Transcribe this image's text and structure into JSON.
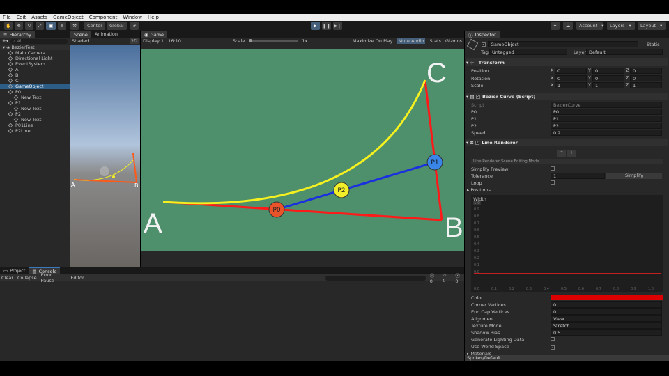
{
  "menu": [
    "File",
    "Edit",
    "Assets",
    "GameObject",
    "Component",
    "Window",
    "Help"
  ],
  "toolbar": {
    "pivot": "Center",
    "space": "Global",
    "account": "Account",
    "layers": "Layers",
    "layout": "Layout"
  },
  "hierarchy": {
    "tab": "Hierarchy",
    "search_placeholder": "All",
    "scene": "BezierTest",
    "items": [
      {
        "label": "Main Camera",
        "indent": 1
      },
      {
        "label": "Directional Light",
        "indent": 1
      },
      {
        "label": "EventSystem",
        "indent": 1
      },
      {
        "label": "A",
        "indent": 1
      },
      {
        "label": "B",
        "indent": 1
      },
      {
        "label": "C",
        "indent": 1
      },
      {
        "label": "GameObject",
        "indent": 1,
        "selected": true
      },
      {
        "label": "P0",
        "indent": 1
      },
      {
        "label": "New Text",
        "indent": 2
      },
      {
        "label": "P1",
        "indent": 1
      },
      {
        "label": "New Text",
        "indent": 2
      },
      {
        "label": "P2",
        "indent": 1
      },
      {
        "label": "New Text",
        "indent": 2
      },
      {
        "label": "P01Line",
        "indent": 1
      },
      {
        "label": "P2Line",
        "indent": 1
      }
    ]
  },
  "scene_view": {
    "tabs": [
      "Scene",
      "Animation"
    ],
    "shading": "Shaded",
    "mode": "2D",
    "labels": {
      "a": "A",
      "b": "B"
    }
  },
  "game_view": {
    "tab": "Game",
    "display": "Display 1",
    "aspect": "16:10",
    "scale_label": "Scale",
    "scale_value": "1x",
    "toggles": [
      "Maximize On Play",
      "Mute Audio",
      "Stats",
      "Gizmos"
    ],
    "background": "#4e8f6c",
    "points": {
      "a": "A",
      "b": "B",
      "c": "C",
      "p0": "P0",
      "p1": "P1",
      "p2": "P2"
    },
    "colors": {
      "red": "#ff1a1a",
      "blue": "#1a2fe0",
      "yellow": "#f5f020",
      "p0": "#e8532a",
      "p1": "#3a86e8",
      "p2": "#f2ee2a"
    }
  },
  "bottom": {
    "tabs": [
      "Project",
      "Console"
    ],
    "buttons": [
      "Clear",
      "Collapse",
      "Error Pause",
      "Editor"
    ],
    "counts": [
      "0",
      "0",
      "0"
    ]
  },
  "inspector": {
    "tab": "Inspector",
    "name": "GameObject",
    "static": "Static",
    "tag_label": "Tag",
    "tag": "Untagged",
    "layer_label": "Layer",
    "layer": "Default",
    "transform": {
      "title": "Transform",
      "position": {
        "label": "Position",
        "x": "0",
        "y": "0",
        "z": "0"
      },
      "rotation": {
        "label": "Rotation",
        "x": "0",
        "y": "0",
        "z": "0"
      },
      "scale": {
        "label": "Scale",
        "x": "1",
        "y": "1",
        "z": "1"
      }
    },
    "bezier": {
      "title": "Bezier Curve (Script)",
      "script_label": "Script",
      "script": "BezierCurve",
      "p0_label": "P0",
      "p0": "P0",
      "p1_label": "P1",
      "p1": "P1",
      "p2_label": "P2",
      "p2": "P2",
      "speed_label": "Speed",
      "speed": "0.2"
    },
    "line_renderer": {
      "title": "Line Renderer",
      "editing_mode": "Line Renderer Scene Editing Mode",
      "simplify_preview": "Simplify Preview",
      "tolerance_label": "Tolerance",
      "tolerance": "1",
      "simplify_button": "Simplify",
      "loop": "Loop",
      "positions": "Positions",
      "width": "Width",
      "width_value": "1.0",
      "y_ticks": [
        "0.9",
        "0.8",
        "0.7",
        "0.6",
        "0.5",
        "0.4",
        "0.3",
        "0.2",
        "0.1",
        "0.0"
      ],
      "x_ticks": [
        "0.0",
        "0.1",
        "0.2",
        "0.3",
        "0.4",
        "0.5",
        "0.6",
        "0.7",
        "0.8",
        "0.9",
        "1.0"
      ],
      "color_label": "Color",
      "color": "#dd0000",
      "corner_label": "Corner Vertices",
      "corner": "0",
      "endcap_label": "End Cap Vertices",
      "endcap": "0",
      "alignment_label": "Alignment",
      "alignment": "View",
      "texture_label": "Texture Mode",
      "texture": "Stretch",
      "shadow_label": "Shadow Bias",
      "shadow": "0.5",
      "lighting_label": "Generate Lighting Data",
      "worldspace_label": "Use World Space",
      "materials": "Materials"
    },
    "footer": "Sprites/Default"
  }
}
